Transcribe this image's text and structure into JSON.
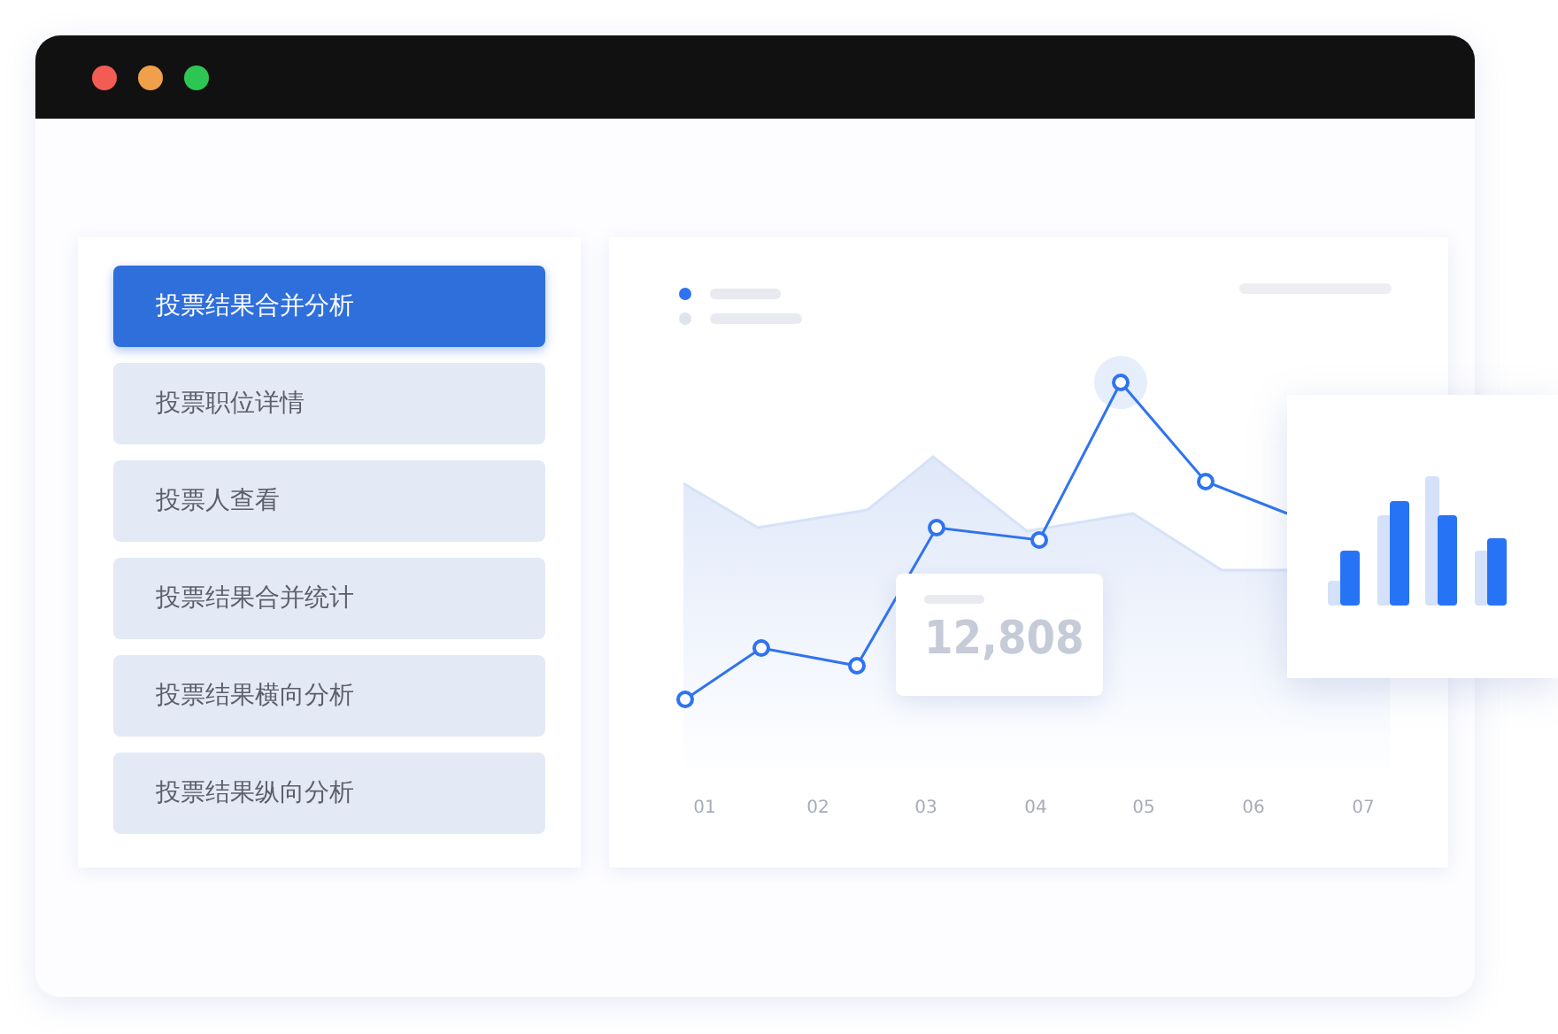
{
  "menu": [
    {
      "label": "投票结果合并分析",
      "selected": true
    },
    {
      "label": "投票职位详情",
      "selected": false
    },
    {
      "label": "投票人查看",
      "selected": false
    },
    {
      "label": "投票结果合并统计",
      "selected": false
    },
    {
      "label": "投票结果横向分析",
      "selected": false
    },
    {
      "label": "投票结果纵向分析",
      "selected": false
    }
  ],
  "chart": {
    "tooltip_value": "12,808",
    "x_labels": [
      "01",
      "02",
      "03",
      "04",
      "05",
      "06",
      "07"
    ]
  }
}
